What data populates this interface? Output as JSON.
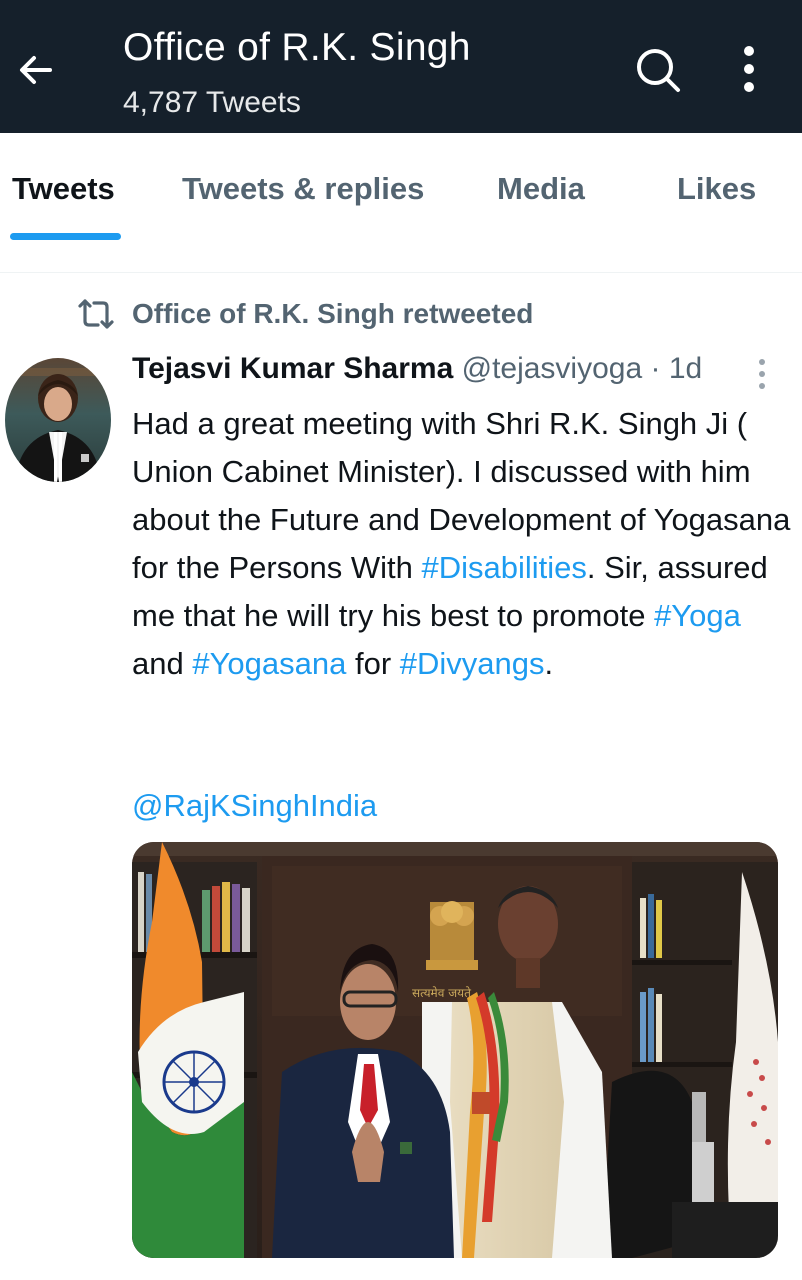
{
  "header": {
    "title": "Office of R.K. Singh",
    "subtitle": "4,787 Tweets",
    "back_icon": "arrow-left-icon",
    "search_icon": "search-icon",
    "more_icon": "more-vertical-icon",
    "background": "#15202b"
  },
  "tabs": [
    {
      "label": "Tweets",
      "active": true
    },
    {
      "label": "Tweets & replies",
      "active": false
    },
    {
      "label": "Media",
      "active": false
    },
    {
      "label": "Likes",
      "active": false
    }
  ],
  "tweet": {
    "retweet_label": "Office of R.K. Singh retweeted",
    "retweet_icon": "retweet-icon",
    "author_name": "Tejasvi Kumar Sharma",
    "author_handle": "@tejasviyoga",
    "separator": "·",
    "time": "1d",
    "body": {
      "p1": "Had a great meeting with Shri R.K. Singh Ji ( Union Cabinet Minister). I discussed with him about the Future and Development of Yogasana for the Persons With ",
      "tag1": "#Disabilities",
      "p2": ". Sir, assured me that he will try his best to promote ",
      "tag2": "#Yoga",
      "p3": " and ",
      "tag3": "#Yogasana",
      "p4": " for ",
      "tag4": "#Divyangs",
      "p5": ".",
      "mention": "@RajKSinghIndia"
    }
  },
  "colors": {
    "accent": "#1d9bf0",
    "text_primary": "#0f1419",
    "text_secondary": "#536471"
  }
}
